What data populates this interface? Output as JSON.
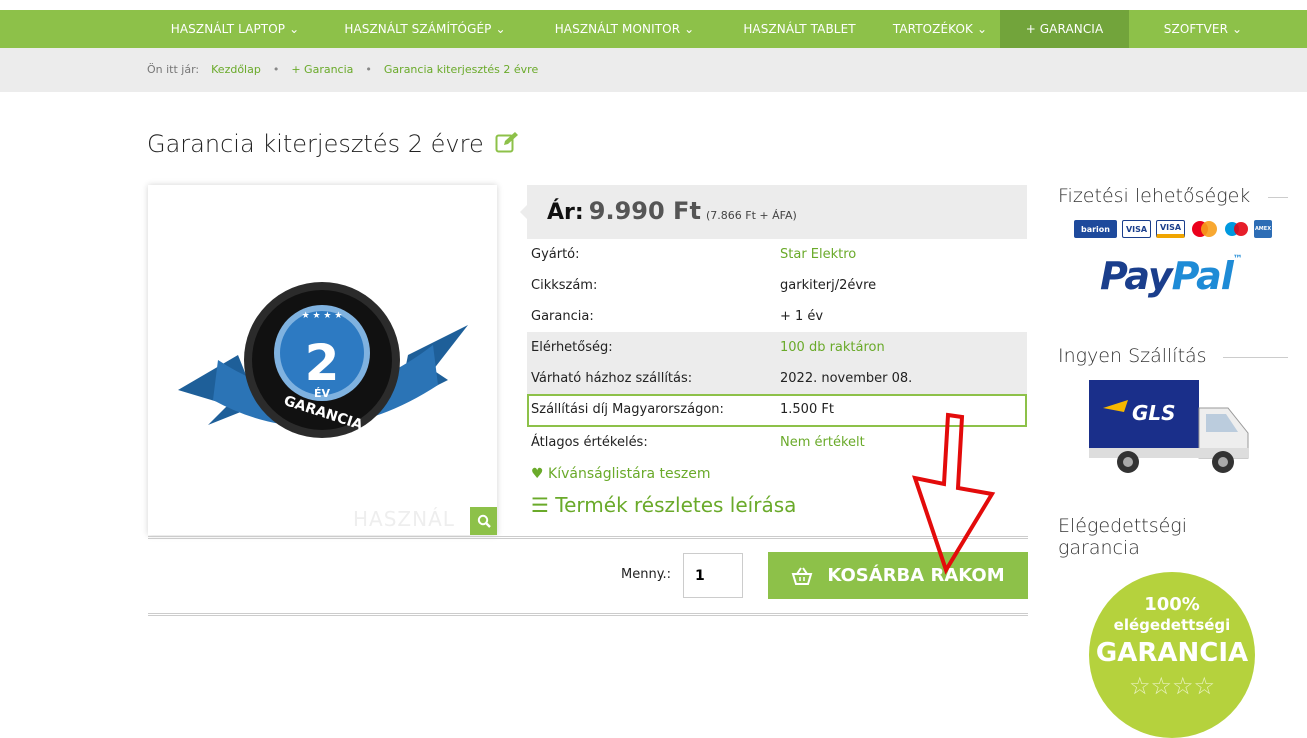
{
  "nav": {
    "items": [
      {
        "label": "HASZNÁLT LAPTOP",
        "chevron": true,
        "active": false
      },
      {
        "label": "HASZNÁLT SZÁMÍTÓGÉP",
        "chevron": true,
        "active": false
      },
      {
        "label": "HASZNÁLT MONITOR",
        "chevron": true,
        "active": false
      },
      {
        "label": "HASZNÁLT TABLET",
        "chevron": false,
        "active": false
      },
      {
        "label": "TARTOZÉKOK",
        "chevron": true,
        "active": false
      },
      {
        "label": "+ GARANCIA",
        "chevron": false,
        "active": true
      },
      {
        "label": "SZOFTVER",
        "chevron": true,
        "active": false
      }
    ]
  },
  "breadcrumb": {
    "prefix": "Ön itt jár:",
    "items": [
      "Kezdőlap",
      "+ Garancia",
      "Garancia kiterjesztés 2 évre"
    ]
  },
  "product": {
    "title": "Garancia kiterjesztés 2 évre",
    "image_text": {
      "number": "2",
      "unit": "ÉV",
      "word": "GARANCIA"
    },
    "watermark": "HASZNÁL",
    "price": {
      "label": "Ár:",
      "value": "9.990 Ft",
      "net": "(7.866 Ft + ÁFA)"
    },
    "specs": [
      {
        "key": "Gyártó:",
        "value": "Star Elektro",
        "green": true,
        "gray": false
      },
      {
        "key": "Cikkszám:",
        "value": "garkiterj/2évre",
        "green": false,
        "gray": false
      },
      {
        "key": "Garancia:",
        "value": "+ 1 év",
        "green": false,
        "gray": false
      },
      {
        "key": "Elérhetőség:",
        "value": "100 db raktáron",
        "green": true,
        "gray": true
      },
      {
        "key": "Várható házhoz szállítás:",
        "value": "2022. november 08.",
        "green": false,
        "gray": true
      },
      {
        "key": "Szállítási díj Magyarországon:",
        "value": "1.500 Ft",
        "green": false,
        "gray": false,
        "boxed": true
      },
      {
        "key": "Átlagos értékelés:",
        "value": "Nem értékelt",
        "green": true,
        "gray": false
      }
    ],
    "wishlist": "Kívánságlistára teszem",
    "details_link": "Termék részletes leírása",
    "quantity_label": "Menny.:",
    "quantity_value": "1",
    "cart_button": "KOSÁRBA RAKOM"
  },
  "sidebar": {
    "payment_title": "Fizetési lehetőségek",
    "cards": [
      "barion",
      "VISA",
      "VISA",
      "mastercard",
      "maestro",
      "AMEX"
    ],
    "paypal": {
      "pay": "Pay",
      "pal": "Pal",
      "tm": "™"
    },
    "shipping_title": "Ingyen Szállítás",
    "shipping_brand": "GLS",
    "satisfaction_title": "Elégedettségi garancia",
    "badge": {
      "percent": "100%",
      "sub": "elégedettségi",
      "main": "GARANCIA",
      "stars": "☆☆☆☆"
    }
  },
  "colors": {
    "brand_green": "#8dc149",
    "link_green": "#6aaa2a",
    "arrow_red": "#e30b0b"
  }
}
